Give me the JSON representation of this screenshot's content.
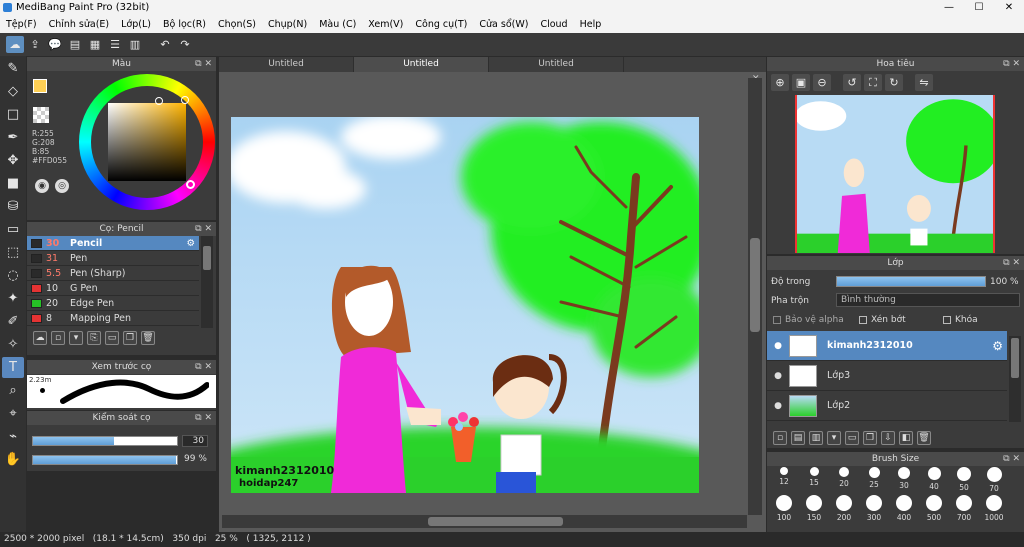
{
  "window": {
    "title": "MediBang Paint Pro (32bit)"
  },
  "menu": [
    "Tệp(F)",
    "Chỉnh sửa(E)",
    "Lớp(L)",
    "Bộ lọc(R)",
    "Chọn(S)",
    "Chụp(N)",
    "Màu (C)",
    "Xem(V)",
    "Công cụ(T)",
    "Cửa sổ(W)",
    "Cloud",
    "Help"
  ],
  "color_panel": {
    "title": "Màu",
    "r": "R:255",
    "g": "G:208",
    "b": "B:85",
    "hex": "#FFD055",
    "fg": "#FFD055"
  },
  "brush_panel": {
    "title": "Cọ: Pencil",
    "items": [
      {
        "size": "30",
        "name": "Pencil",
        "color": "#2a2a2a",
        "selected": true
      },
      {
        "size": "31",
        "name": "Pen",
        "color": "#2a2a2a"
      },
      {
        "size": "5.5",
        "name": "Pen (Sharp)",
        "color": "#2a2a2a"
      },
      {
        "size": "10",
        "name": "G Pen",
        "color": "#e53333"
      },
      {
        "size": "20",
        "name": "Edge Pen",
        "color": "#26c226"
      },
      {
        "size": "8",
        "name": "Mapping Pen",
        "color": "#e53333"
      }
    ]
  },
  "preview_panel": {
    "title": "Xem trước cọ",
    "size_label": "2.23m"
  },
  "control_panel": {
    "title": "Kiểm soát cọ",
    "size_value": "30",
    "opacity_value": "99 %",
    "size_fraction": 0.56,
    "opacity_fraction": 0.99
  },
  "tabs": [
    "Untitled",
    "Untitled",
    "Untitled"
  ],
  "active_tab": 1,
  "canvas": {
    "watermark1": "kimanh2312010",
    "watermark2": "hoidap247"
  },
  "navigator": {
    "title": "Hoa tiêu"
  },
  "layer_panel": {
    "title": "Lớp",
    "opacity_label": "Độ trong",
    "opacity_value": "100 %",
    "blend_label": "Pha trộn",
    "blend_value": "Bình thường",
    "alpha_label": "Bảo vệ alpha",
    "clip_label": "Xén bớt",
    "lock_label": "Khóa",
    "layers": [
      {
        "name": "kimanh2312010",
        "selected": true
      },
      {
        "name": "Lớp3"
      },
      {
        "name": "Lớp2"
      }
    ]
  },
  "brush_size_panel": {
    "title": "Brush Size",
    "row1": [
      "12",
      "15",
      "20",
      "25",
      "30",
      "40",
      "50",
      "70"
    ],
    "row2": [
      "100",
      "150",
      "200",
      "300",
      "400",
      "500",
      "700",
      "1000"
    ]
  },
  "status": {
    "text": "2500 * 2000 pixel   (18.1 * 14.5cm)   350 dpi   25 %   ( 1325, 2112 )"
  }
}
